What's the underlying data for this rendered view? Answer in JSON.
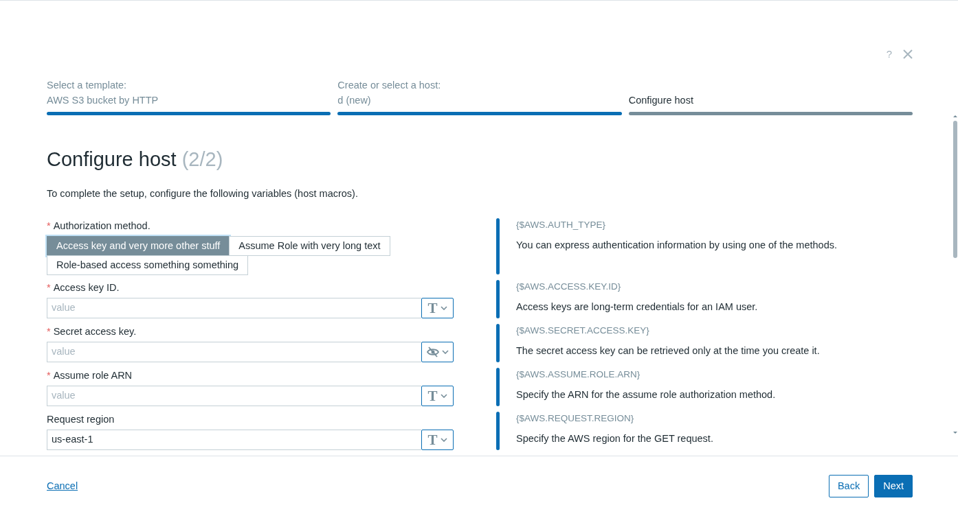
{
  "header_actions": {
    "help": "?"
  },
  "steps": [
    {
      "label": "Select a template:",
      "value": "AWS S3 bucket by HTTP",
      "completed": true
    },
    {
      "label": "Create or select a host:",
      "value": "d (new)",
      "completed": true
    },
    {
      "value": "Configure host",
      "completed": false
    }
  ],
  "title": "Configure host",
  "title_counter": "(2/2)",
  "intro": "To complete the setup, configure the following variables (host macros).",
  "fields": [
    {
      "kind": "segmented",
      "required_mark": "*",
      "label": "Authorization method.",
      "options": [
        {
          "label": "Access key and very more other stuff",
          "selected": true
        },
        {
          "label": "Assume Role with very long text",
          "selected": false
        },
        {
          "label": "Role-based access something something",
          "selected": false
        }
      ],
      "macro": "{$AWS.AUTH_TYPE}",
      "description": "You can express authentication information by using one of the methods."
    },
    {
      "kind": "input",
      "required_mark": "*",
      "label": "Access key ID.",
      "placeholder": "value",
      "masked": false,
      "type_glyph": "T",
      "macro": "{$AWS.ACCESS.KEY.ID}",
      "description": "Access keys are long-term credentials for an IAM user."
    },
    {
      "kind": "input",
      "required_mark": "*",
      "label": "Secret access key.",
      "placeholder": "value",
      "masked": true,
      "macro": "{$AWS.SECRET.ACCESS.KEY}",
      "description": "The secret access key can be retrieved only at the time you create it."
    },
    {
      "kind": "input",
      "required_mark": "*",
      "label": "Assume role ARN",
      "placeholder": "value",
      "masked": false,
      "type_glyph": "T",
      "macro": "{$AWS.ASSUME.ROLE.ARN}",
      "description": "Specify the ARN for the assume role authorization method."
    },
    {
      "kind": "input",
      "label": "Request region",
      "value": "us-east-1",
      "masked": false,
      "type_glyph": "T",
      "macro": "{$AWS.REQUEST.REGION}",
      "description": "Specify the AWS region for the GET request."
    }
  ],
  "footer": {
    "cancel": "Cancel",
    "back": "Back",
    "next": "Next"
  }
}
